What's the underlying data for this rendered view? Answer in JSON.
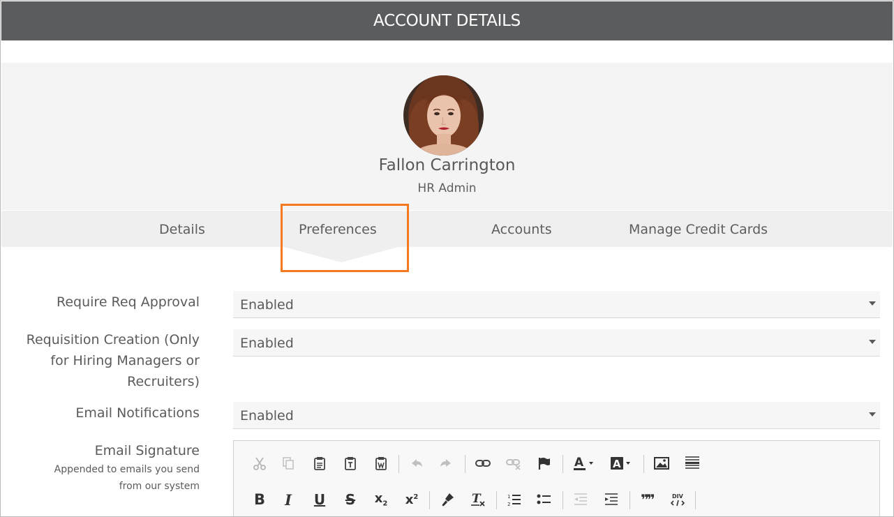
{
  "header": {
    "title": "ACCOUNT DETAILS"
  },
  "profile": {
    "name": "Fallon Carrington",
    "role": "HR Admin"
  },
  "tabs": [
    {
      "label": "Details"
    },
    {
      "label": "Preferences",
      "active": true
    },
    {
      "label": "Accounts"
    },
    {
      "label": "Manage Credit Cards"
    }
  ],
  "form": {
    "require_req_approval": {
      "label": "Require Req Approval",
      "value": "Enabled"
    },
    "requisition_creation": {
      "label_lines": [
        "Requisition Creation (Only",
        "for Hiring Managers or",
        "Recruiters)"
      ],
      "value": "Enabled"
    },
    "email_notifications": {
      "label": "Email Notifications",
      "value": "Enabled"
    },
    "email_signature": {
      "label": "Email Signature",
      "help_lines": [
        "Appended to emails you send",
        "from our system"
      ]
    }
  },
  "toolbar": {
    "row1": [
      "cut-icon",
      "copy-icon",
      "paste-icon",
      "paste-text-icon",
      "paste-word-icon",
      "undo-icon",
      "redo-icon",
      "link-icon",
      "unlink-icon",
      "anchor-flag-icon",
      "text-color-icon",
      "background-color-icon",
      "image-icon",
      "horizontal-rule-icon"
    ],
    "row2": [
      "bold-icon",
      "italic-icon",
      "underline-icon",
      "strikethrough-icon",
      "subscript-icon",
      "superscript-icon",
      "copy-formatting-icon",
      "remove-format-icon",
      "numbered-list-icon",
      "bulleted-list-icon",
      "decrease-indent-icon",
      "increase-indent-icon",
      "blockquote-icon",
      "create-div-icon"
    ],
    "glyphs": {
      "bold": "B",
      "italic": "I",
      "underline": "U",
      "strike": "S",
      "sub": "x",
      "sub_mark": "2",
      "sup": "x",
      "sup_mark": "2",
      "color_letter": "A",
      "quote": "❞❞",
      "div": "DIV"
    }
  },
  "colors": {
    "header_bg": "#5b5c5e",
    "highlight": "#f47920",
    "profile_bg": "#f4f4f4",
    "tabs_bg": "#efefef"
  }
}
